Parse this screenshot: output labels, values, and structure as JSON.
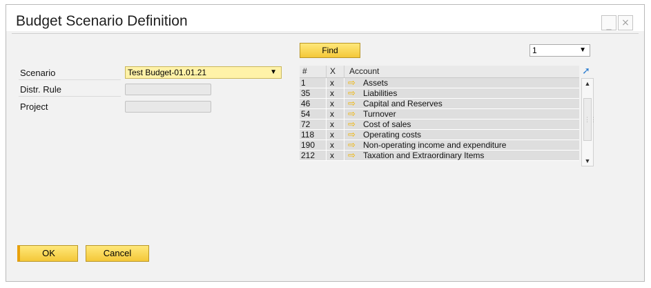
{
  "window": {
    "title": "Budget Scenario Definition",
    "minimize_glyph": "_",
    "close_glyph": "×"
  },
  "form": {
    "scenario_label": "Scenario",
    "scenario_value": "Test Budget-01.01.21",
    "distr_rule_label": "Distr. Rule",
    "distr_rule_value": "",
    "project_label": "Project",
    "project_value": ""
  },
  "toolbar": {
    "find_label": "Find",
    "page_value": "1"
  },
  "grid": {
    "headers": {
      "num": "#",
      "x": "X",
      "account": "Account"
    },
    "rows": [
      {
        "num": "1",
        "x": "x",
        "account": "Assets"
      },
      {
        "num": "35",
        "x": "x",
        "account": "Liabilities"
      },
      {
        "num": "46",
        "x": "x",
        "account": "Capital and Reserves"
      },
      {
        "num": "54",
        "x": "x",
        "account": "Turnover"
      },
      {
        "num": "72",
        "x": "x",
        "account": "Cost of sales"
      },
      {
        "num": "118",
        "x": "x",
        "account": "Operating costs"
      },
      {
        "num": "190",
        "x": "x",
        "account": "Non-operating income and expenditure"
      },
      {
        "num": "212",
        "x": "x",
        "account": "Taxation and Extraordinary Items"
      }
    ]
  },
  "buttons": {
    "ok_label": "OK",
    "cancel_label": "Cancel"
  },
  "icons": {
    "link_arrow": "arrow-right-icon",
    "expand": "expand-icon",
    "dropdown": "chevron-down-icon"
  },
  "colors": {
    "accent_yellow": "#f4c839",
    "field_yellow": "#fff2a8",
    "link_arrow": "#f0b400",
    "expand_blue": "#2e7fd1"
  }
}
